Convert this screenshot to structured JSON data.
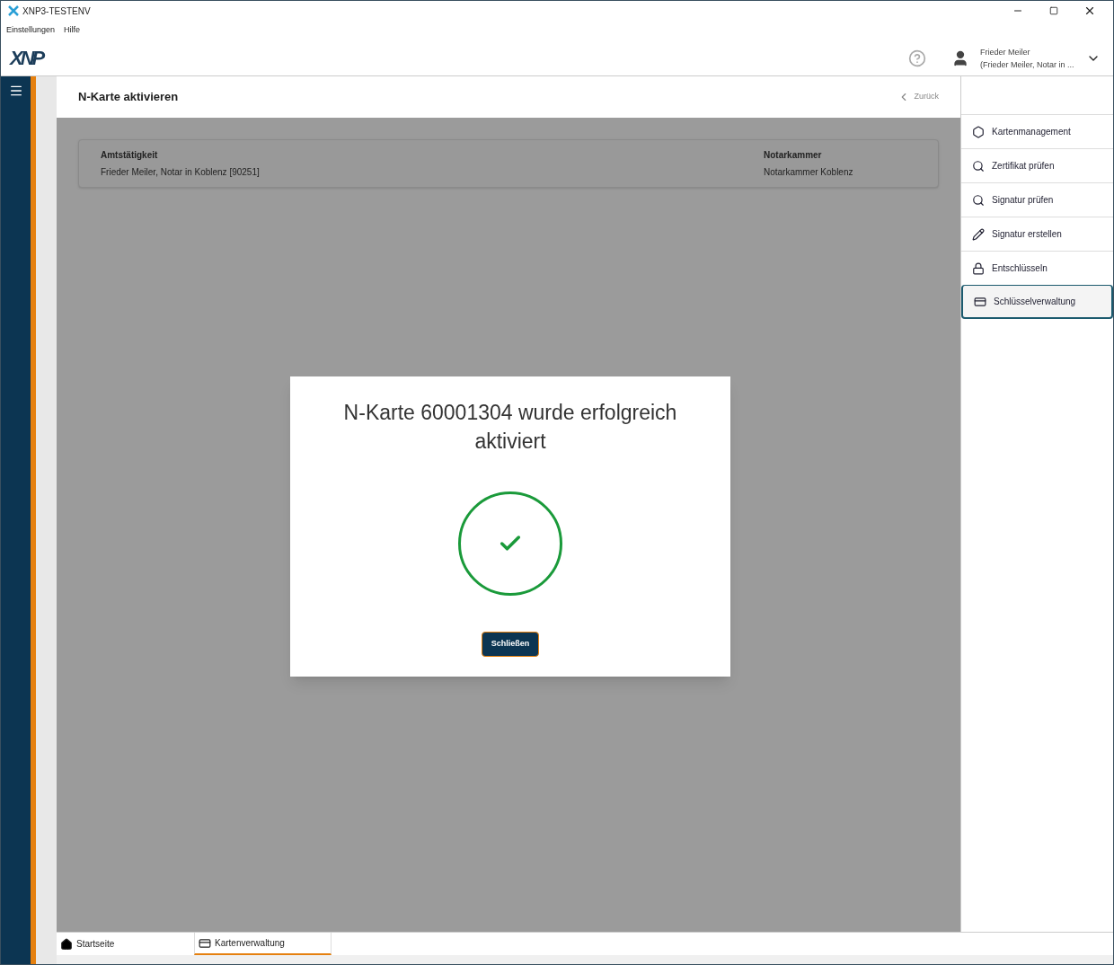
{
  "window": {
    "title": "XNP3-TESTENV"
  },
  "menu": [
    "Einstellungen",
    "Hilfe"
  ],
  "logo": "XNP",
  "user": {
    "name": "Frieder Meiler",
    "role": "(Frieder Meiler, Notar in ..."
  },
  "page": {
    "title": "N-Karte aktivieren",
    "back": "Zurück"
  },
  "info": [
    {
      "label": "Amtstätigkeit",
      "value": "Frieder Meiler, Notar in Koblenz [90251]"
    },
    {
      "label": "Notarkammer",
      "value": "Notarkammer Koblenz"
    }
  ],
  "dialog": {
    "message": "N-Karte 60001304 wurde erfolgreich aktiviert",
    "button": "Schließen"
  },
  "sidebar": {
    "items": [
      {
        "label": "Kartenmanagement",
        "kind": "gear",
        "selected": false
      },
      {
        "label": "Zertifikat prüfen",
        "kind": "search",
        "selected": false
      },
      {
        "label": "Signatur prüfen",
        "kind": "search",
        "selected": false
      },
      {
        "label": "Signatur erstellen",
        "kind": "pen",
        "selected": false
      },
      {
        "label": "Entschlüsseln",
        "kind": "lock",
        "selected": false
      },
      {
        "label": "Schlüsselverwaltung",
        "kind": "card",
        "selected": true
      }
    ]
  },
  "tabs": [
    {
      "label": "Startseite",
      "kind": "home",
      "selected": false
    },
    {
      "label": "Kartenverwaltung",
      "kind": "card",
      "selected": true
    }
  ]
}
